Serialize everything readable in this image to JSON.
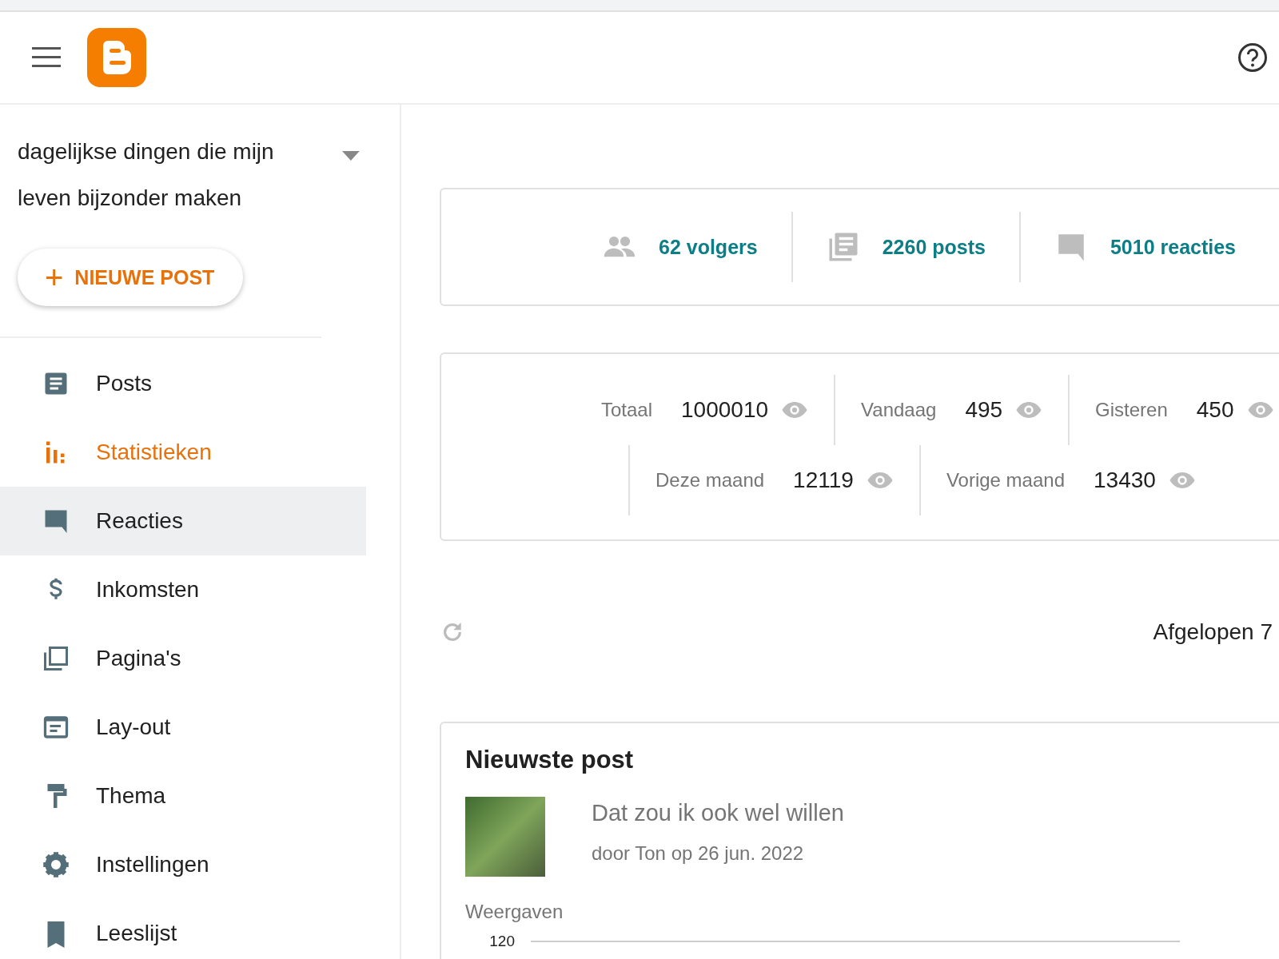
{
  "blog_title": "dagelijkse dingen die mijn leven bijzonder maken",
  "new_post_button": {
    "icon": "+",
    "label": "NIEUWE POST"
  },
  "sidebar": {
    "items": [
      {
        "kind": "posts",
        "label": "Posts",
        "selected": false,
        "hovered": false
      },
      {
        "kind": "stats",
        "label": "Statistieken",
        "selected": true,
        "hovered": false
      },
      {
        "kind": "comments",
        "label": "Reacties",
        "selected": false,
        "hovered": true
      },
      {
        "kind": "earnings",
        "label": "Inkomsten",
        "selected": false,
        "hovered": false
      },
      {
        "kind": "pages",
        "label": "Pagina's",
        "selected": false,
        "hovered": false
      },
      {
        "kind": "layout",
        "label": "Lay-out",
        "selected": false,
        "hovered": false
      },
      {
        "kind": "theme",
        "label": "Thema",
        "selected": false,
        "hovered": false
      },
      {
        "kind": "settings",
        "label": "Instellingen",
        "selected": false,
        "hovered": false
      },
      {
        "kind": "reading",
        "label": "Leeslijst",
        "selected": false,
        "hovered": false
      }
    ]
  },
  "summary": [
    {
      "kind": "followers",
      "text": "62 volgers"
    },
    {
      "kind": "posts",
      "text": "2260 posts"
    },
    {
      "kind": "comments",
      "text": "5010 reacties"
    }
  ],
  "views": {
    "rows": [
      [
        {
          "label": "Totaal",
          "value": "1000010"
        },
        {
          "label": "Vandaag",
          "value": "495"
        },
        {
          "label": "Gisteren",
          "value": "450"
        }
      ],
      [
        {
          "label": "Deze maand",
          "value": "12119"
        },
        {
          "label": "Vorige maand",
          "value": "13430"
        }
      ]
    ]
  },
  "period": "Afgelopen 7",
  "latest_post": {
    "heading": "Nieuwste post",
    "title": "Dat zou ik ook wel willen",
    "byline": "door Ton op 26 jun. 2022",
    "chart_label": "Weergaven",
    "y_tick": "120"
  }
}
